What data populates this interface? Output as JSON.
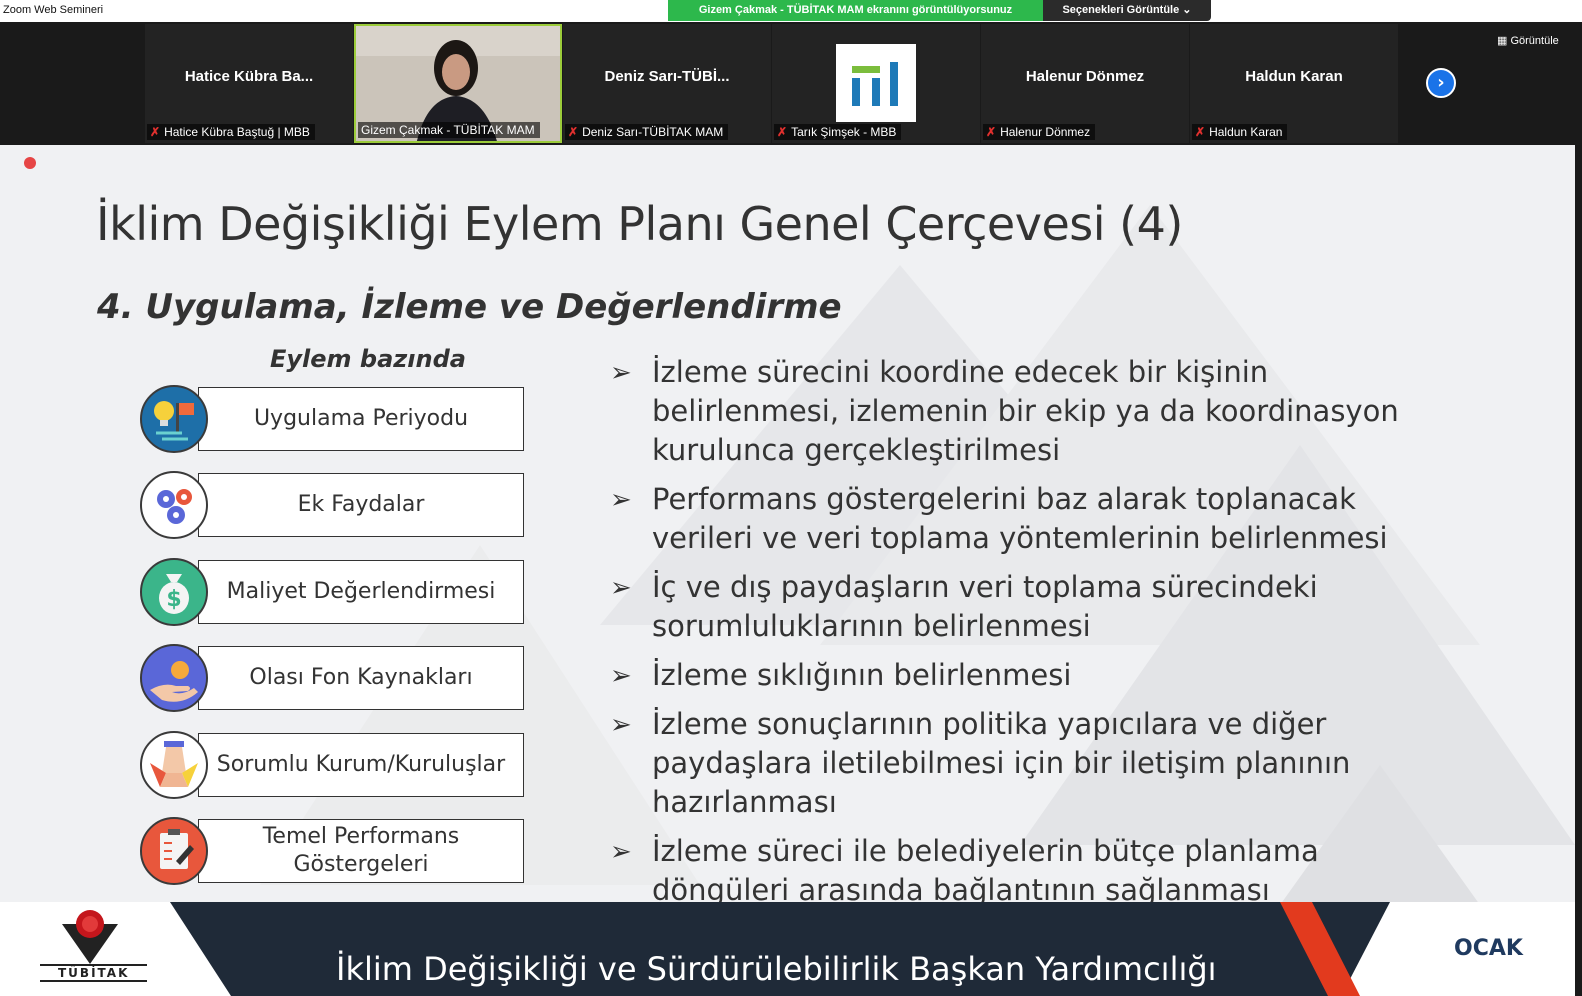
{
  "app": {
    "title": "Zoom Web Semineri",
    "share_banner": "Gizem Çakmak - TÜBİTAK MAM ekranını görüntülüyorsunuz",
    "share_options": "Seçenekleri Görüntüle ⌄",
    "view_label": "Görüntüle"
  },
  "participants": [
    {
      "name": "Hatice Kübra Ba...",
      "label": "Hatice Kübra Baştuğ | MBB",
      "muted": true
    },
    {
      "name": "",
      "label": "Gizem Çakmak - TÜBİTAK MAM",
      "muted": false,
      "video": true
    },
    {
      "name": "Deniz Sarı-TÜBİ...",
      "label": "Deniz Sarı-TÜBİTAK MAM",
      "muted": true
    },
    {
      "name": "",
      "label": "Tarık Şimşek - MBB",
      "muted": true,
      "logo": true
    },
    {
      "name": "Halenur Dönmez",
      "label": "Halenur Dönmez",
      "muted": true
    },
    {
      "name": "Haldun Karan",
      "label": "Haldun Karan",
      "muted": true
    }
  ],
  "slide": {
    "title": "İklim Değişikliği Eylem Planı Genel Çerçevesi (4)",
    "subtitle": "4. Uygulama, İzleme ve Değerlendirme",
    "action_heading": "Eylem bazında",
    "actions": [
      {
        "label": "Uygulama Periyodu",
        "icon": "lightbulb-flag-icon",
        "color": "#1e6fa8"
      },
      {
        "label": "Ek Faydalar",
        "icon": "gears-icon",
        "color": "#ffffff"
      },
      {
        "label": "Maliyet Değerlendirmesi",
        "icon": "money-bag-icon",
        "color": "#3bb58a"
      },
      {
        "label": "Olası Fon Kaynakları",
        "icon": "hand-coin-icon",
        "color": "#5a67d8"
      },
      {
        "label": "Sorumlu Kurum/Kuruluşlar",
        "icon": "handshake-icon",
        "color": "#ffffff"
      },
      {
        "label": "Temel Performans Göstergeleri",
        "icon": "clipboard-icon",
        "color": "#e8573c"
      }
    ],
    "bullets": [
      "İzleme sürecini koordine edecek bir kişinin belirlenmesi, izlemenin bir ekip ya da koordinasyon kurulunca gerçekleştirilmesi",
      "Performans göstergelerini baz alarak toplanacak verileri ve veri toplama yöntemlerinin belirlenmesi",
      "İç ve dış paydaşların veri toplama sürecindeki sorumluluklarının belirlenmesi",
      "İzleme sıklığının belirlenmesi",
      "İzleme sonuçlarının politika yapıcılara ve diğer paydaşlara iletilebilmesi için bir iletişim planının hazırlanması",
      "İzleme süreci ile belediyelerin bütçe planlama döngüleri arasında bağlantının sağlanması"
    ],
    "footer_text": "İklim Değişikliği ve Sürdürülebilirlik Başkan Yardımcılığı",
    "footer_right": "OCAK",
    "logo_text": "TÜBİTAK"
  }
}
